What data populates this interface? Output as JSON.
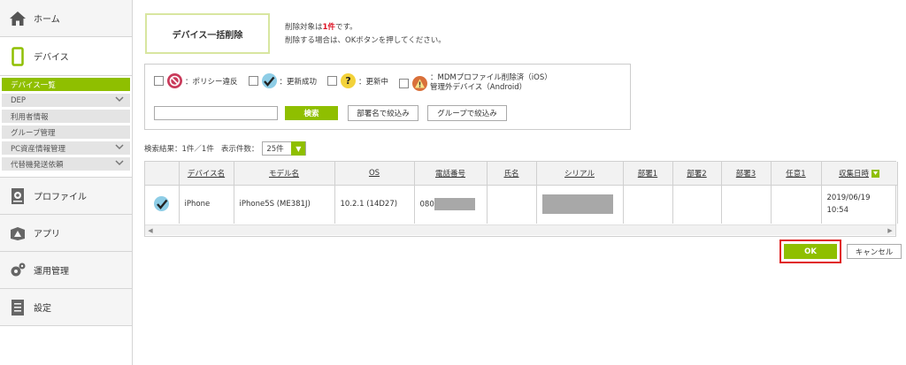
{
  "sidebar": {
    "home": "ホーム",
    "device": "デバイス",
    "sub_items": [
      {
        "label": "デバイス一覧",
        "active": true,
        "chevron": false
      },
      {
        "label": "DEP",
        "active": false,
        "chevron": true
      },
      {
        "label": "利用者情報",
        "active": false,
        "chevron": false
      },
      {
        "label": "グループ管理",
        "active": false,
        "chevron": false
      },
      {
        "label": "PC資産情報管理",
        "active": false,
        "chevron": true
      },
      {
        "label": "代替機発送依頼",
        "active": false,
        "chevron": true
      }
    ],
    "profile": "プロファイル",
    "app": "アプリ",
    "operation": "運用管理",
    "settings": "設定"
  },
  "page": {
    "title": "デバイス一括削除",
    "msg_prefix": "削除対象は",
    "msg_count": "1件",
    "msg_suffix": "です。",
    "msg_line2": "削除する場合は、OKボタンを押してください。"
  },
  "filter": {
    "policy_violation": "：ポリシー違反",
    "update_success": "：更新成功",
    "updating": "：更新中",
    "mdm_line1": "：MDMプロファイル削除済（iOS）",
    "mdm_line2": "管理外デバイス（Android）",
    "search_placeholder": "",
    "search_button": "検索",
    "dept_button": "部署名で絞込み",
    "group_button": "グループで絞込み"
  },
  "result": {
    "summary": "検索結果：1件／1件",
    "per_page_label": "表示件数：",
    "per_page_value": "25件"
  },
  "table": {
    "headers": [
      "デバイス名",
      "モデル名",
      "OS",
      "電話番号",
      "氏名",
      "シリアル",
      "部署1",
      "部署2",
      "部署3",
      "任意1",
      "収集日時"
    ],
    "row": {
      "device_name": "iPhone",
      "model": "iPhone5S (ME381J)",
      "os": "10.2.1 (14D27)",
      "phone_prefix": "080",
      "name": "",
      "dept1": "",
      "dept2": "",
      "dept3": "",
      "optional1": "",
      "date_line1": "2019/06/19",
      "date_line2": "10:54"
    }
  },
  "actions": {
    "ok": "OK",
    "cancel": "キャンセル"
  },
  "colors": {
    "accent": "#8fbf00",
    "highlight": "#e02020"
  }
}
